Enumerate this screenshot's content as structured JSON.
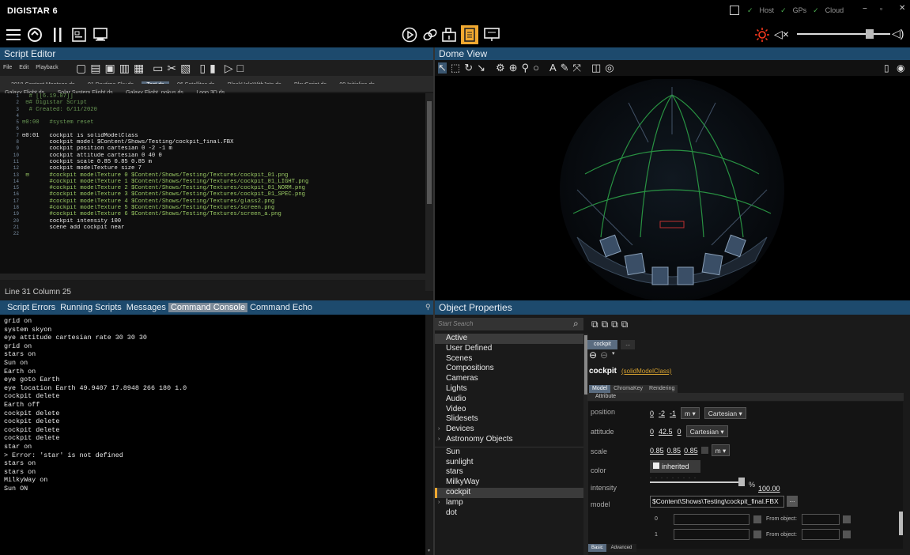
{
  "app": {
    "title": "DIGISTAR 6"
  },
  "window": {
    "host_label": "Host",
    "gps_label": "GPs",
    "cloud_label": "Cloud",
    "minimize_icon": "minus-icon",
    "restore_icon": "restore-icon",
    "close_icon": "close-icon",
    "status_color": "#4caf50"
  },
  "toolbar": {
    "icons_left": [
      "hamburger-menu-icon",
      "refresh-icon",
      "pause-icon",
      "script-icon",
      "image-icon"
    ],
    "icons_center": [
      "play-icon",
      "link-icon",
      "camera-bag-icon",
      "document-icon",
      "presentation-icon"
    ],
    "active_center": "document-icon",
    "sun_icon_color": "#ff3b1f"
  },
  "script_editor": {
    "title": "Script Editor",
    "menu": [
      "File",
      "Edit",
      "Playback"
    ],
    "tabs_row1": [
      "2018 Content Montage.ds",
      "01 Daytime Sky.ds",
      "Test.ds",
      "06 Satellites.ds",
      "BlackHoleWithJets.ds",
      "PlayScript.ds",
      "00 Initialise.ds"
    ],
    "tabs_row2": [
      "Galaxy Flight.ds",
      "Solar System Flight.ds",
      "Galaxy Flight_pokus.ds",
      "Logo 3D.ds"
    ],
    "active_tab": "Test.ds",
    "lines": [
      {
        "n": "1",
        "t": "  # [[6.19.07]]",
        "c": "#6a9955"
      },
      {
        "n": "2",
        "t": " ⊟# Digistar Script",
        "c": "#6a9955"
      },
      {
        "n": "3",
        "t": "  # Created: 6/11/2020",
        "c": "#6a9955"
      },
      {
        "n": "4",
        "t": "",
        "c": "#ddd"
      },
      {
        "n": "5",
        "t": "⊟0:00   #system reset",
        "c": "#6a9955"
      },
      {
        "n": "6",
        "t": "",
        "c": "#ddd"
      },
      {
        "n": "7",
        "t": "⊟0:01   cockpit is solidModelClass",
        "c": "#e8e8e8"
      },
      {
        "n": "8",
        "t": "        cockpit model $Content/Shows/Testing/cockpit_final.FBX",
        "c": "#e8e8e8"
      },
      {
        "n": "9",
        "t": "        cockpit position cartesian 0 -2 -1 m",
        "c": "#e8e8e8"
      },
      {
        "n": "10",
        "t": "        cockpit attitude cartesian 0 40 0",
        "c": "#e8e8e8"
      },
      {
        "n": "11",
        "t": "        cockpit scale 0.85 0.85 0.85 m",
        "c": "#e8e8e8"
      },
      {
        "n": "12",
        "t": "        cockpit modelTexture size 7",
        "c": "#e8e8e8"
      },
      {
        "n": "13",
        "t": " ⊟      #cockpit modelTexture 0 $Content/Shows/Testing/Textures/cockpit_01.png",
        "c": "#9ccc65"
      },
      {
        "n": "14",
        "t": "        #cockpit modelTexture 1 $Content/Shows/Testing/Textures/cockpit_01_LIGHT.png",
        "c": "#9ccc65"
      },
      {
        "n": "15",
        "t": "        #cockpit modelTexture 2 $Content/Shows/Testing/Textures/cockpit_01_NORM.png",
        "c": "#9ccc65"
      },
      {
        "n": "16",
        "t": "        #cockpit modelTexture 3 $Content/Shows/Testing/Textures/cockpit_01_SPEC.png",
        "c": "#9ccc65"
      },
      {
        "n": "17",
        "t": "        #cockpit modelTexture 4 $Content/Shows/Testing/Textures/glass2.png",
        "c": "#9ccc65"
      },
      {
        "n": "18",
        "t": "        #cockpit modelTexture 5 $Content/Shows/Testing/Textures/screen.png",
        "c": "#9ccc65"
      },
      {
        "n": "19",
        "t": "        #cockpit modelTexture 6 $Content/Shows/Testing/Textures/screen_a.png",
        "c": "#9ccc65"
      },
      {
        "n": "20",
        "t": "        cockpit intensity 100",
        "c": "#e8e8e8"
      },
      {
        "n": "21",
        "t": "        scene add cockpit near",
        "c": "#e8e8e8"
      },
      {
        "n": "22",
        "t": "",
        "c": "#ddd"
      }
    ],
    "status": "Line  31  Column  25"
  },
  "dome_view": {
    "title": "Dome View"
  },
  "console": {
    "tabs": [
      "Script Errors",
      "Running Scripts",
      "Messages",
      "Command Console",
      "Command Echo"
    ],
    "active_tab": "Command Console",
    "lines": [
      "grid on",
      "system skyon",
      "eye attitude cartesian rate 30 30 30",
      "grid on",
      "stars on",
      "Sun on",
      "Earth on",
      "eye goto Earth",
      "eye location Earth 49.9407 17.8948 266 180 1.0",
      "cockpit delete",
      "Earth off",
      "cockpit delete",
      "cockpit delete",
      "cockpit delete",
      "cockpit delete",
      "star on",
      "> Error: 'star' is not defined",
      "stars on",
      "stars on",
      "MilkyWay on",
      "Sun ON"
    ]
  },
  "object_properties": {
    "title": "Object Properties",
    "search_placeholder": "Start Search",
    "categories": [
      "Active",
      "User Defined",
      "Scenes",
      "Compositions",
      "Cameras",
      "Lights",
      "Audio",
      "Video",
      "Slidesets",
      "Devices",
      "Astronomy Objects"
    ],
    "expandable": [
      "Devices",
      "Astronomy Objects"
    ],
    "objects": [
      "Sun",
      "sunlight",
      "stars",
      "MilkyWay",
      "cockpit",
      "lamp",
      "dot"
    ],
    "selected": "cockpit",
    "object_tab": "cockpit",
    "object_tab_more": "...",
    "object_name": "cockpit",
    "object_class": "(solidModelClass)",
    "subtabs": [
      "Model",
      "ChromaKey",
      "Rendering"
    ],
    "attribute_header": "Attribute",
    "position_label": "position",
    "position_values": [
      "0",
      "-2",
      "-1"
    ],
    "position_unit": "m",
    "position_system": "Cartesian",
    "attitude_label": "attitude",
    "attitude_values": [
      "0",
      "42.5",
      "0"
    ],
    "attitude_system": "Cartesian",
    "scale_label": "scale",
    "scale_values": [
      "0.85",
      "0.85",
      "0.85"
    ],
    "scale_unit": "m",
    "color_label": "color",
    "color_value": "inherited",
    "intensity_label": "intensity",
    "intensity_value": "100.00",
    "intensity_unit": "%",
    "intensity_fraction": 1.0,
    "model_label": "model",
    "model_value": "$Content\\Shows\\Testing\\cockpit_final.FBX",
    "model_btn": "...",
    "texture_rows": [
      {
        "idx": "0",
        "from": "From object:"
      },
      {
        "idx": "1",
        "from": "From object:"
      }
    ],
    "bottom_tabs": [
      "Basic",
      "Advanced"
    ]
  }
}
